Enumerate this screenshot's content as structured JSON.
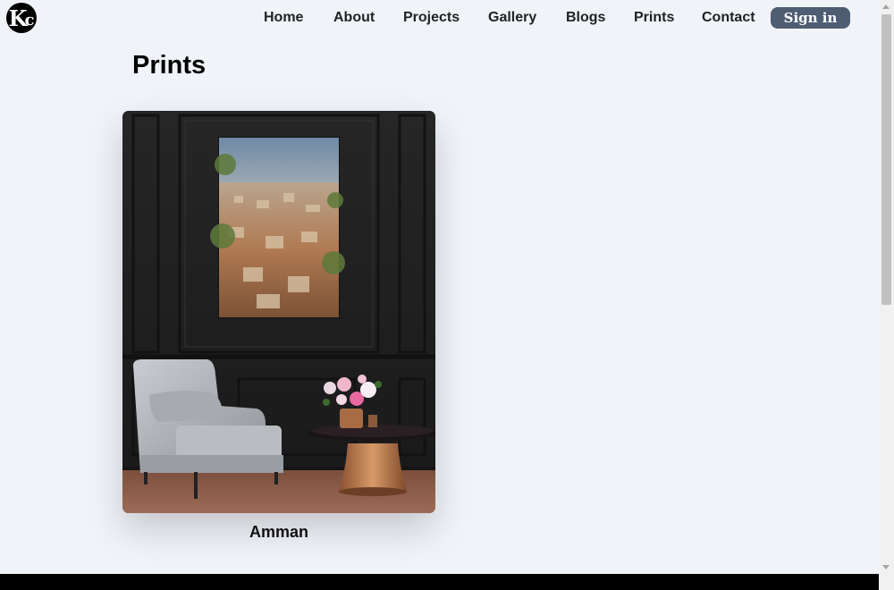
{
  "brand": {
    "logo_letter": "K",
    "logo_mark": "c"
  },
  "nav": {
    "items": [
      {
        "label": "Home"
      },
      {
        "label": "About"
      },
      {
        "label": "Projects"
      },
      {
        "label": "Gallery"
      },
      {
        "label": "Blogs"
      },
      {
        "label": "Prints"
      },
      {
        "label": "Contact"
      }
    ],
    "signin_label": "Sign in"
  },
  "page": {
    "title": "Prints"
  },
  "prints": [
    {
      "caption": "Amman",
      "image": "framed-city-print-mockup"
    }
  ],
  "colors": {
    "background": "#f0f3f8",
    "signin_bg": "#4e5d72",
    "footer": "#000000"
  }
}
